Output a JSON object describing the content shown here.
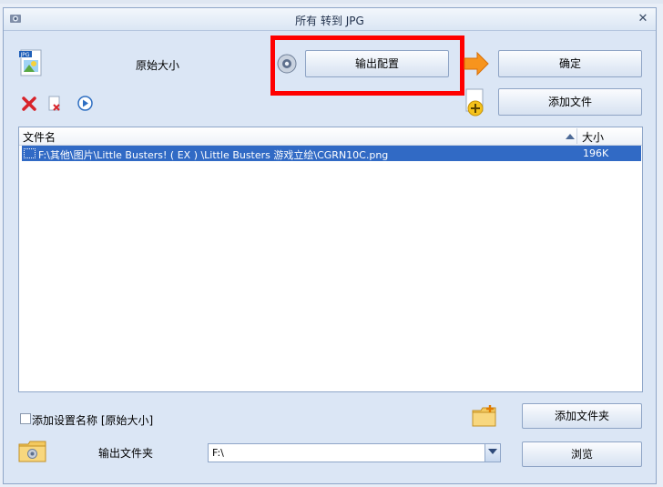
{
  "window": {
    "title": "所有 转到 JPG"
  },
  "settings": {
    "size_label": "原始大小",
    "output_config_label": "输出配置"
  },
  "actions": {
    "ok_label": "确定",
    "add_file_label": "添加文件"
  },
  "file_list": {
    "columns": [
      "文件名",
      "大小"
    ],
    "rows": [
      {
        "name": "F:\\其他\\图片\\Little Busters! ( EX ) \\Little Busters 游戏立绘\\CGRN10C.png",
        "size": "196K"
      }
    ]
  },
  "options": {
    "add_setting_name_label": "添加设置名称 [原始大小]",
    "add_setting_name_checked": false
  },
  "output": {
    "folder_label": "输出文件夹",
    "folder_value": "F:\\",
    "add_folder_label": "添加文件夹",
    "browse_label": "浏览"
  },
  "icons": [
    "app-icon",
    "close-icon",
    "jpg-format-icon",
    "delete-icon",
    "remove-file-icon",
    "play-icon",
    "settings-gear-icon",
    "arrow-right-icon",
    "add-file-icon",
    "add-folder-icon",
    "output-folder-icon",
    "dropdown-arrow-icon"
  ],
  "colors": {
    "selection": "#316ac5",
    "highlight_box": "#ff0000",
    "arrow": "#f7941d"
  }
}
